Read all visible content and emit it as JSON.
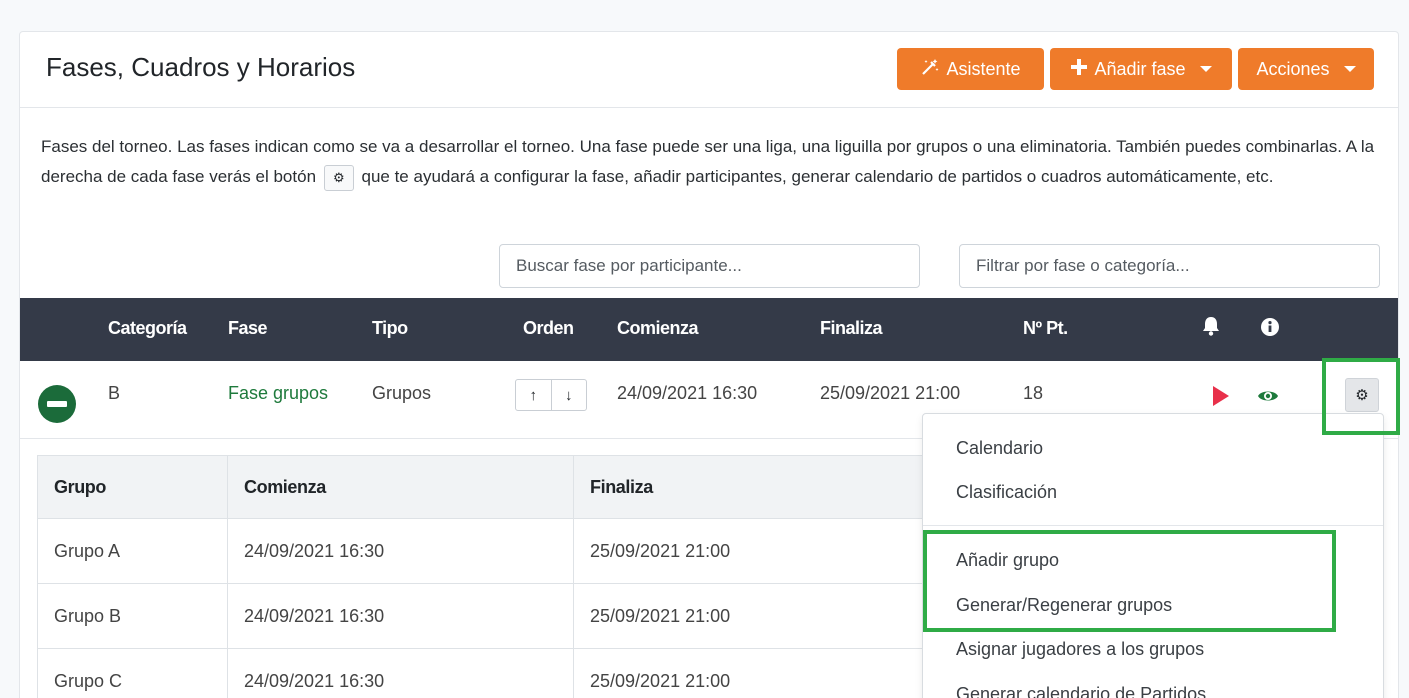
{
  "header": {
    "title": "Fases, Cuadros y Horarios",
    "assistant_button": "Asistente",
    "add_phase_button": "Añadir fase",
    "actions_button": "Acciones"
  },
  "description": {
    "part1": "Fases del torneo. Las fases indican como se va a desarrollar el torneo. Una fase puede ser una liga, una liguilla por grupos o una eliminatoria. También puedes combinarlas. A la derecha de cada fase verás el botón",
    "part2": "que te ayudará a configurar la fase, añadir participantes, generar calendario de partidos o cuadros automáticamente, etc."
  },
  "filters": {
    "participant_placeholder": "Buscar fase por participante...",
    "phase_placeholder": "Filtrar por fase o categoría..."
  },
  "table": {
    "headers": {
      "category": "Categoría",
      "phase": "Fase",
      "type": "Tipo",
      "order": "Orden",
      "starts": "Comienza",
      "ends": "Finaliza",
      "num_pt": "Nº Pt."
    },
    "row": {
      "category": "B",
      "phase": "Fase grupos",
      "type": "Grupos",
      "starts": "24/09/2021 16:30",
      "ends": "25/09/2021 21:00",
      "num_pt": "18"
    }
  },
  "groups": {
    "headers": [
      "Grupo",
      "Comienza",
      "Finaliza"
    ],
    "rows": [
      [
        "Grupo A",
        "24/09/2021 16:30",
        "25/09/2021 21:00"
      ],
      [
        "Grupo B",
        "24/09/2021 16:30",
        "25/09/2021 21:00"
      ],
      [
        "Grupo C",
        "24/09/2021 16:30",
        "25/09/2021 21:00"
      ]
    ]
  },
  "dropdown": {
    "items": [
      "Calendario",
      "Clasificación",
      "Añadir grupo",
      "Generar/Regenerar grupos",
      "Asignar jugadores a los grupos",
      "Generar calendario de Partidos"
    ]
  },
  "colors": {
    "accent": "#ef7b2a",
    "header_bg": "#343a48",
    "link": "#1e7a3c",
    "highlight": "#2fab46",
    "play": "#e8304a"
  }
}
